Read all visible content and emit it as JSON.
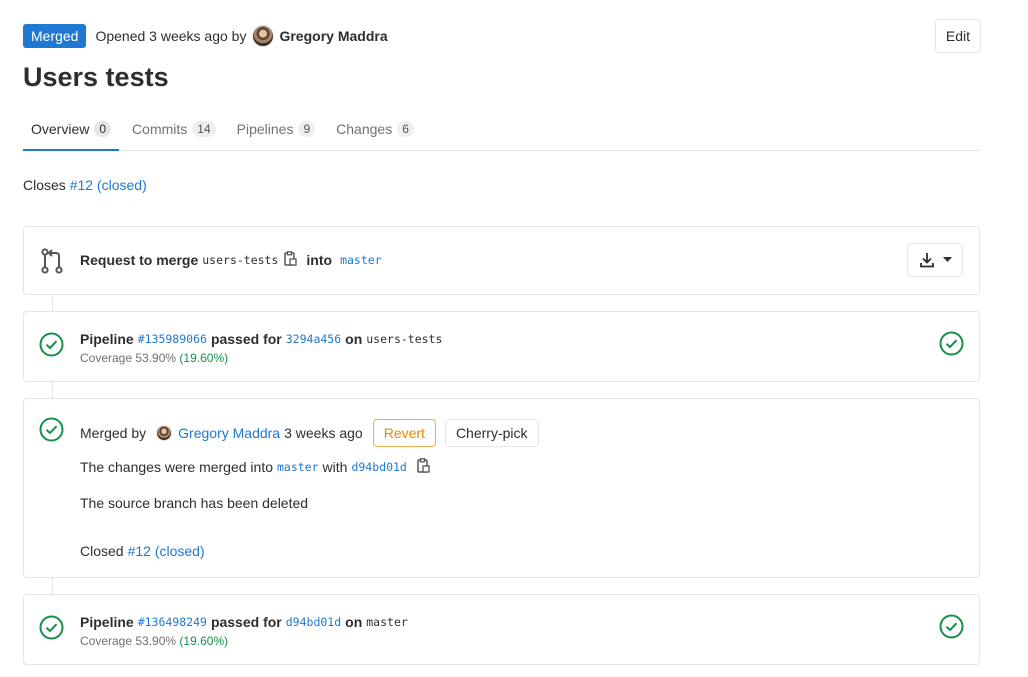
{
  "header": {
    "status_badge": "Merged",
    "opened_text": "Opened 3 weeks ago by",
    "author": "Gregory Maddra",
    "edit_label": "Edit"
  },
  "title": "Users tests",
  "tabs": [
    {
      "label": "Overview",
      "count": "0"
    },
    {
      "label": "Commits",
      "count": "14"
    },
    {
      "label": "Pipelines",
      "count": "9"
    },
    {
      "label": "Changes",
      "count": "6"
    }
  ],
  "closes": {
    "prefix": "Closes",
    "link": "#12 (closed)"
  },
  "merge_request": {
    "label": "Request to merge",
    "source_branch": "users-tests",
    "into": "into",
    "target_branch": "master"
  },
  "pipeline1": {
    "label": "Pipeline",
    "id": "#135989066",
    "passed_for": "passed for",
    "commit": "3294a456",
    "on": "on",
    "branch": "users-tests",
    "coverage_label": "Coverage 53.90%",
    "coverage_delta": "(19.60%)"
  },
  "merged": {
    "merged_by": "Merged by",
    "author": "Gregory Maddra",
    "time": "3 weeks ago",
    "revert_label": "Revert",
    "cherry_label": "Cherry-pick",
    "changes_text": "The changes were merged into",
    "target_branch": "master",
    "with": "with",
    "commit": "d94bd01d",
    "source_deleted": "The source branch has been deleted",
    "closed_prefix": "Closed",
    "closed_link": "#12 (closed)"
  },
  "pipeline2": {
    "label": "Pipeline",
    "id": "#136498249",
    "passed_for": "passed for",
    "commit": "d94bd01d",
    "on": "on",
    "branch": "master",
    "coverage_label": "Coverage 53.90%",
    "coverage_delta": "(19.60%)"
  },
  "colors": {
    "accent": "#1f78d1",
    "success": "#168f48",
    "warning": "#e28a00"
  }
}
